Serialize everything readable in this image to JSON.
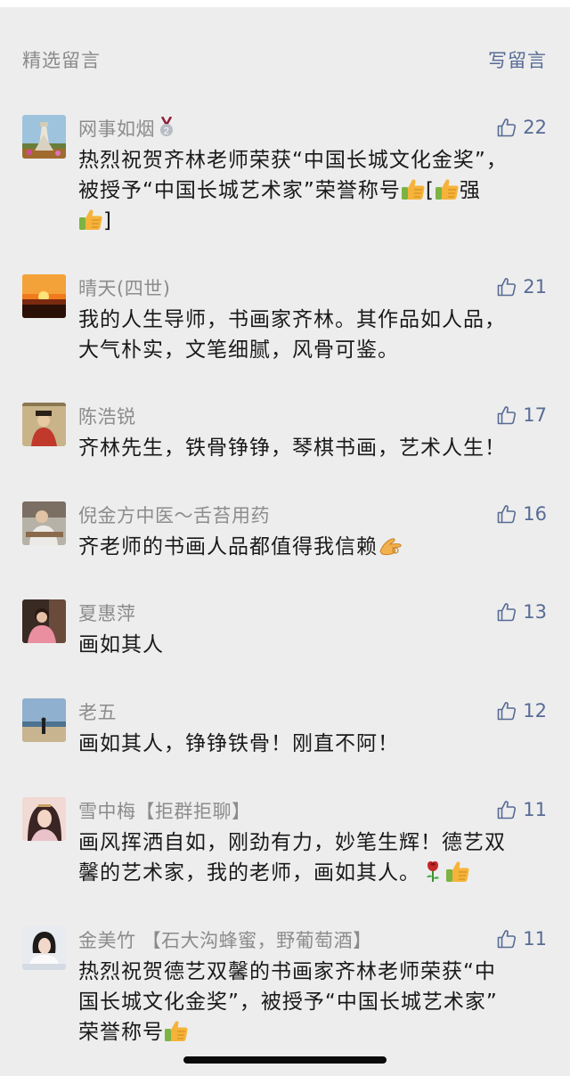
{
  "header": {
    "title": "精选留言",
    "write": "写留言"
  },
  "comments": [
    {
      "name": "网事如烟",
      "likes": "22",
      "lines": [
        "热烈祝贺齐林老师荣获“中国长城文化金奖”，",
        "被授予“中国长城艺术家”荣誉称号",
        "[",
        "强",
        "]"
      ]
    },
    {
      "name": "晴天(四世)",
      "likes": "21",
      "lines": [
        "我的人生导师，书画家齐林。其作品如人品，",
        "大气朴实，文笔细腻，风骨可鉴。"
      ]
    },
    {
      "name": "陈浩锐",
      "likes": "17",
      "lines": [
        "齐林先生，铁骨铮铮，琴棋书画，艺术人生！"
      ]
    },
    {
      "name": "倪金方中医～舌苔用药",
      "likes": "16",
      "lines": [
        "齐老师的书画人品都值得我信赖"
      ]
    },
    {
      "name": "夏惠萍",
      "likes": "13",
      "lines": [
        "画如其人"
      ]
    },
    {
      "name": "老五",
      "likes": "12",
      "lines": [
        "画如其人，铮铮铁骨！刚直不阿！"
      ]
    },
    {
      "name": "雪中梅【拒群拒聊】",
      "likes": "11",
      "lines": [
        "画风挥洒自如，刚劲有力，妙笔生辉！德艺双",
        "馨的艺术家，我的老师，画如其人。"
      ]
    },
    {
      "name": "金美竹 【石大沟蜂蜜，野葡萄酒】",
      "likes": "11",
      "lines": [
        "热烈祝贺德艺双馨的书画家齐林老师荣获“中",
        "国长城文化金奖”，被授予“中国长城艺术家”",
        "荣誉称号"
      ]
    }
  ],
  "icons": {
    "like": "thumbs-up-outline-icon",
    "emoji_thumb": "thumbs-up-emoji-icon",
    "emoji_ok": "ok-hand-emoji-icon",
    "emoji_rose": "rose-emoji-icon",
    "medal": "medal-2-icon"
  },
  "colors": {
    "link": "#576b95",
    "name": "#8c8c8c",
    "text": "#1a1a1a",
    "bg": "#ededed"
  }
}
